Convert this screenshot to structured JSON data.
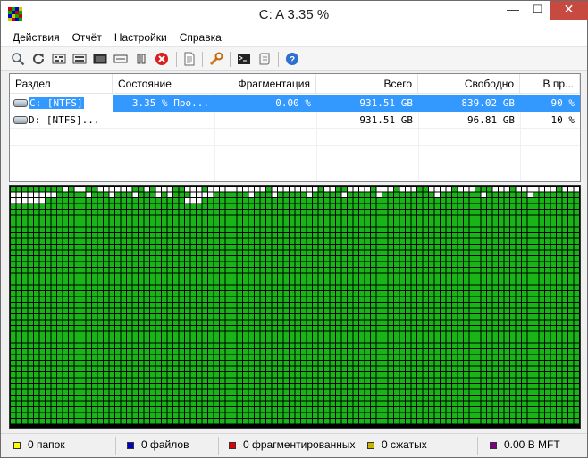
{
  "window": {
    "title": "C:  A   3.35 %"
  },
  "controls": {
    "minimize": "—",
    "maximize": "☐",
    "close": "✕"
  },
  "menu": [
    "Действия",
    "Отчёт",
    "Настройки",
    "Справка"
  ],
  "toolbar": {
    "icons": [
      "magnifier-icon",
      "refresh-icon",
      "defrag-icon",
      "full-optimize-icon",
      "mft-optimize-icon",
      "flat-rect-icon",
      "pause-icon",
      "stop-icon",
      "report-icon",
      "settings-wrench-icon",
      "console-icon",
      "script-icon",
      "help-icon"
    ]
  },
  "list": {
    "columns": [
      "Раздел",
      "Состояние",
      "Фрагментация",
      "Всего",
      "Свободно",
      "В пр..."
    ],
    "rows": [
      {
        "drive": "C: [NTFS]",
        "status": "3.35 % Про...",
        "fragmentation": "0.00 %",
        "total": "931.51 GB",
        "free": "839.02 GB",
        "percent": "90 %",
        "selected": true
      },
      {
        "drive": "D: [NTFS]...",
        "status": "",
        "fragmentation": "",
        "total": "931.51 GB",
        "free": "96.81 GB",
        "percent": "10 %",
        "selected": false
      }
    ]
  },
  "colors": {
    "used": "#18b418",
    "free": "#ffffff",
    "grid": "#000000",
    "selection": "#3399ff",
    "legend": [
      "#ffff00",
      "#0000c8",
      "#e00000",
      "#c8b400",
      "#800080"
    ]
  },
  "statusbar": {
    "folders": "0 папок",
    "files": "0 файлов",
    "fragmented": "0 фрагментированных",
    "compressed": "0 сжатых",
    "mft": "0.00 В MFT"
  }
}
